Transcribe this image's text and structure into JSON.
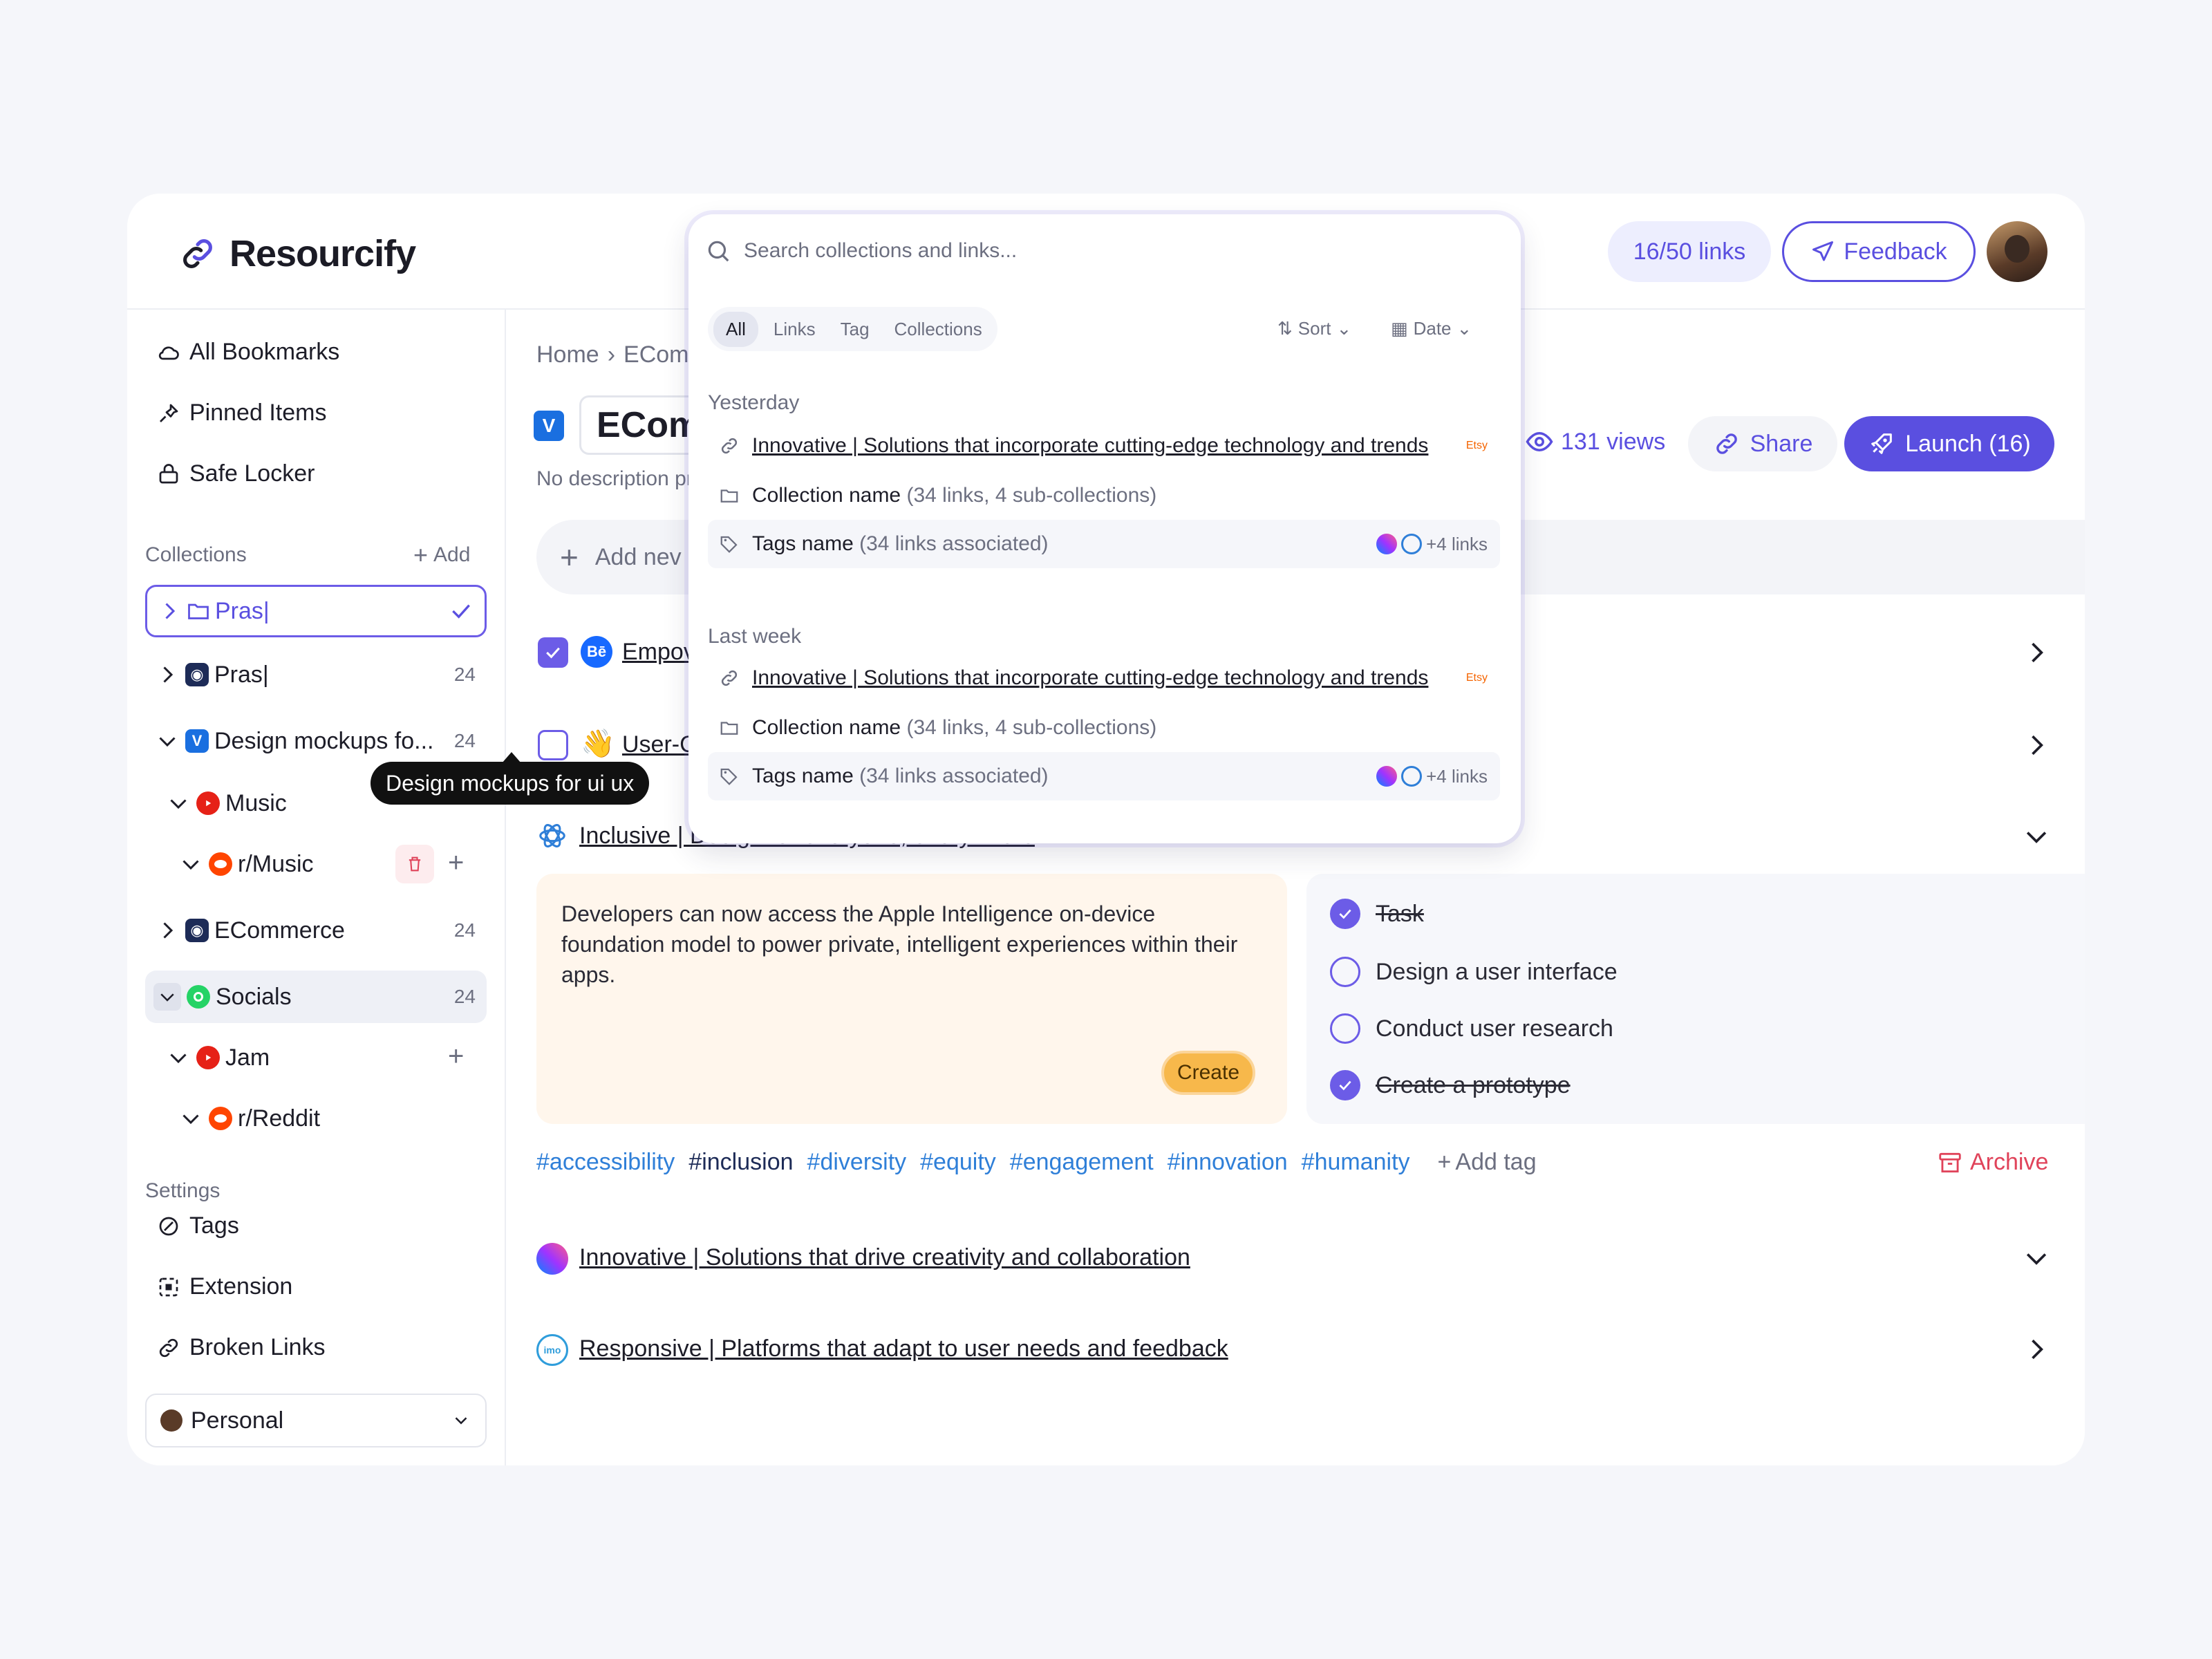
{
  "app": {
    "name": "Resourcify"
  },
  "header": {
    "links_count": "16/50 links",
    "feedback_label": "Feedback"
  },
  "sidebar": {
    "nav": [
      "All Bookmarks",
      "Pinned Items",
      "Safe Locker"
    ],
    "collections_title": "Collections",
    "add_label": "Add",
    "new_collection_value": "Pras|",
    "tree": [
      {
        "label": "Pras|",
        "count": "24"
      },
      {
        "label": "Design mockups fo...",
        "count": "24"
      },
      {
        "label": "Music"
      },
      {
        "label": "r/Music"
      },
      {
        "label": "ECommerce",
        "count": "24"
      },
      {
        "label": "Socials",
        "count": "24"
      },
      {
        "label": "Jam"
      },
      {
        "label": "r/Reddit"
      }
    ],
    "tooltip": "Design mockups for ui ux",
    "settings_title": "Settings",
    "settings": [
      "Tags",
      "Extension",
      "Broken Links"
    ],
    "workspace": "Personal"
  },
  "main": {
    "breadcrumb": {
      "home": "Home",
      "current": "ECom"
    },
    "title_partial": "ECom",
    "description_partial": "No description pr",
    "add_new_partial": "Add nev",
    "views": "131 views",
    "share_label": "Share",
    "launch_label": "Launch (16)",
    "items": [
      {
        "title": "Empov"
      },
      {
        "title": "User-C"
      },
      {
        "title": "Inclusive | Design for everyone, everywhere"
      },
      {
        "title": "Innovative | Solutions that drive creativity and collaboration"
      },
      {
        "title": "Responsive | Platforms that adapt to user needs and feedback"
      }
    ],
    "note": {
      "text": "Developers can now access the Apple Intelligence on-device foundation model to power private, intelligent experiences within their apps.",
      "create_label": "Create"
    },
    "tasks": [
      {
        "label": "Task",
        "done": true
      },
      {
        "label": "Design a user interface",
        "done": false
      },
      {
        "label": "Conduct user research",
        "done": false
      },
      {
        "label": "Create a prototype",
        "done": true
      }
    ],
    "tags": [
      "#accessibility",
      "#inclusion",
      "#diversity",
      "#equity",
      "#engagement",
      "#innovation",
      "#humanity"
    ],
    "add_tag_label": "Add tag",
    "archive_label": "Archive"
  },
  "search": {
    "placeholder": "Search collections and links...",
    "filters": [
      "All",
      "Links",
      "Tag",
      "Collections"
    ],
    "sort_label": "Sort",
    "date_label": "Date",
    "groups": [
      {
        "title": "Yesterday",
        "link": "Innovative | Solutions that incorporate cutting-edge technology and trends",
        "collection_name": "Collection name",
        "collection_meta": "(34 links, 4 sub-collections)",
        "tag_name": "Tags name",
        "tag_meta": "(34 links associated)",
        "more_links": "+4 links",
        "source": "Etsy"
      },
      {
        "title": "Last week",
        "link": "Innovative | Solutions that incorporate cutting-edge technology and trends",
        "collection_name": "Collection name",
        "collection_meta": "(34 links, 4 sub-collections)",
        "tag_name": "Tags name",
        "tag_meta": "(34 links associated)",
        "more_links": "+4 links",
        "source": "Etsy"
      }
    ]
  },
  "colors": {
    "accent": "#5a4fe0",
    "archive": "#e0435a",
    "tag": "#2f7fd8",
    "note_bg": "#fff6ec",
    "create": "#f7b84b"
  }
}
